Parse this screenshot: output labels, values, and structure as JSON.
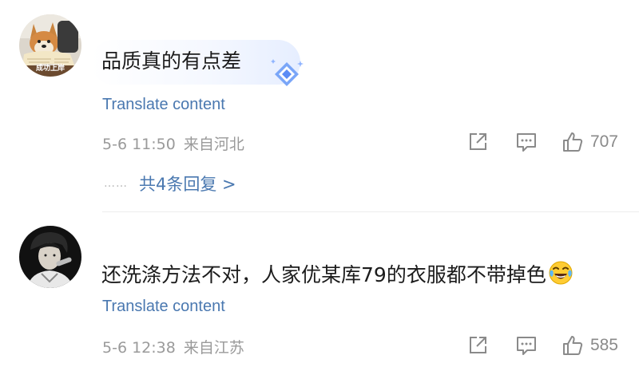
{
  "comments": [
    {
      "avatar": {
        "caption": "成功上岸",
        "icon": "shiba-dog-avatar"
      },
      "text": "品质真的有点差",
      "translate_label": "Translate content",
      "date": "5-6 11:50",
      "location": "来自河北",
      "likes": "707",
      "replies_label": "共4条回复 >",
      "replies_dots": "……"
    },
    {
      "avatar": {
        "icon": "singer-avatar"
      },
      "text": "还洗涤方法不对，人家优某库79的衣服都不带掉色",
      "emoji": "laughing-crying-emoji",
      "translate_label": "Translate content",
      "date": "5-6 12:38",
      "location": "来自江苏",
      "likes": "585"
    }
  ],
  "colors": {
    "link": "#4a78b0",
    "meta": "#9a9a9a",
    "badge": "#5b8cf5"
  }
}
